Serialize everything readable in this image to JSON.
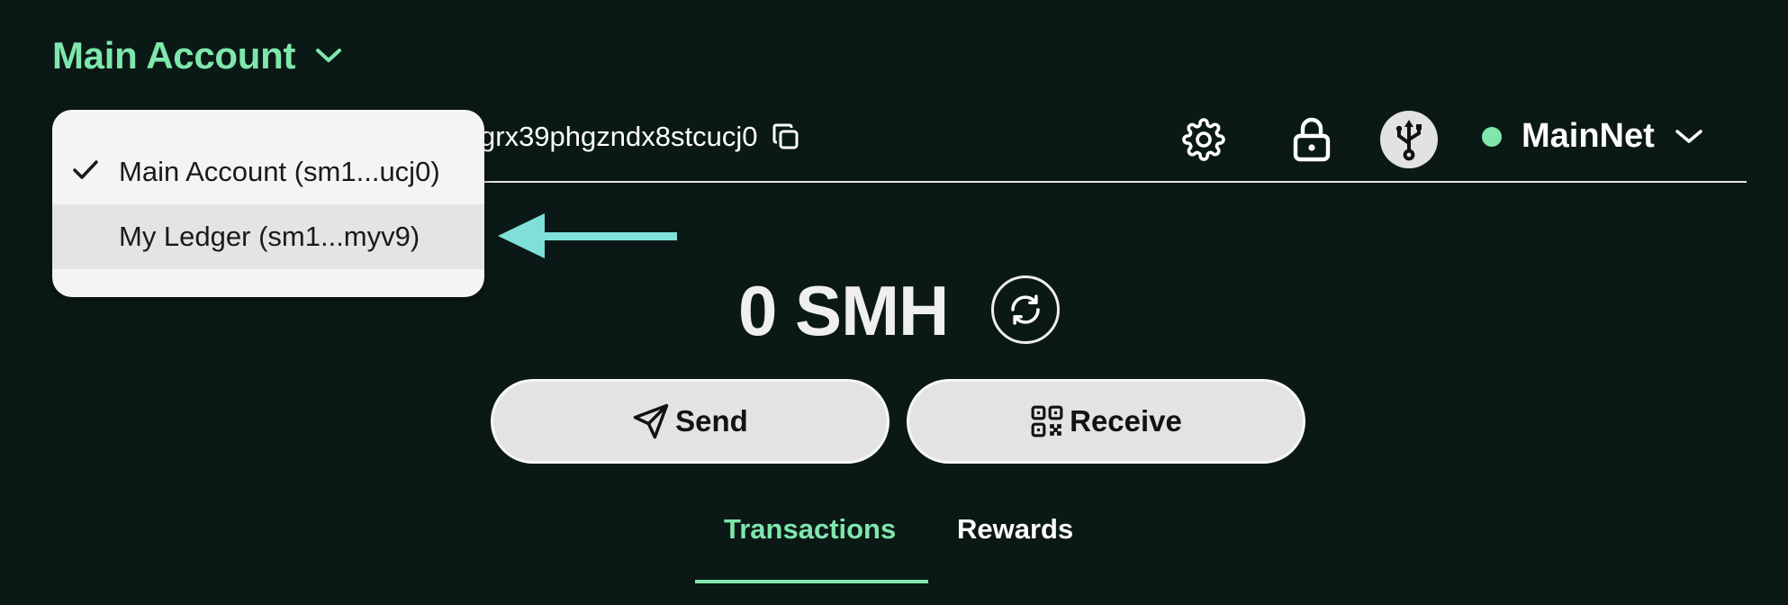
{
  "header": {
    "account_title": "Main Account",
    "address_visible": "grx39phgzndx8stcucj0",
    "network_label": "MainNet",
    "network_status_color": "#7fe7ac"
  },
  "dropdown": {
    "items": [
      {
        "label": "Main Account (sm1...ucj0)",
        "selected": true
      },
      {
        "label": "My Ledger (sm1...myv9)",
        "selected": false,
        "highlighted": true
      }
    ]
  },
  "balance": {
    "amount": "0 SMH"
  },
  "actions": {
    "send_label": "Send",
    "receive_label": "Receive"
  },
  "tabs": [
    {
      "label": "Transactions",
      "active": true
    },
    {
      "label": "Rewards",
      "active": false
    }
  ],
  "icons": {
    "account_chevron": "chevron-down-icon",
    "copy": "copy-icon",
    "settings": "gear-icon",
    "lock": "lock-icon",
    "ledger": "usb-icon",
    "network_chevron": "chevron-down-icon",
    "refresh": "refresh-icon",
    "send": "paper-plane-icon",
    "receive": "qr-code-icon",
    "check": "check-icon",
    "annotation": "arrow-left-icon"
  },
  "colors": {
    "background": "#0b1916",
    "accent": "#7fe7ac",
    "annotation_arrow": "#7fe0d8"
  }
}
